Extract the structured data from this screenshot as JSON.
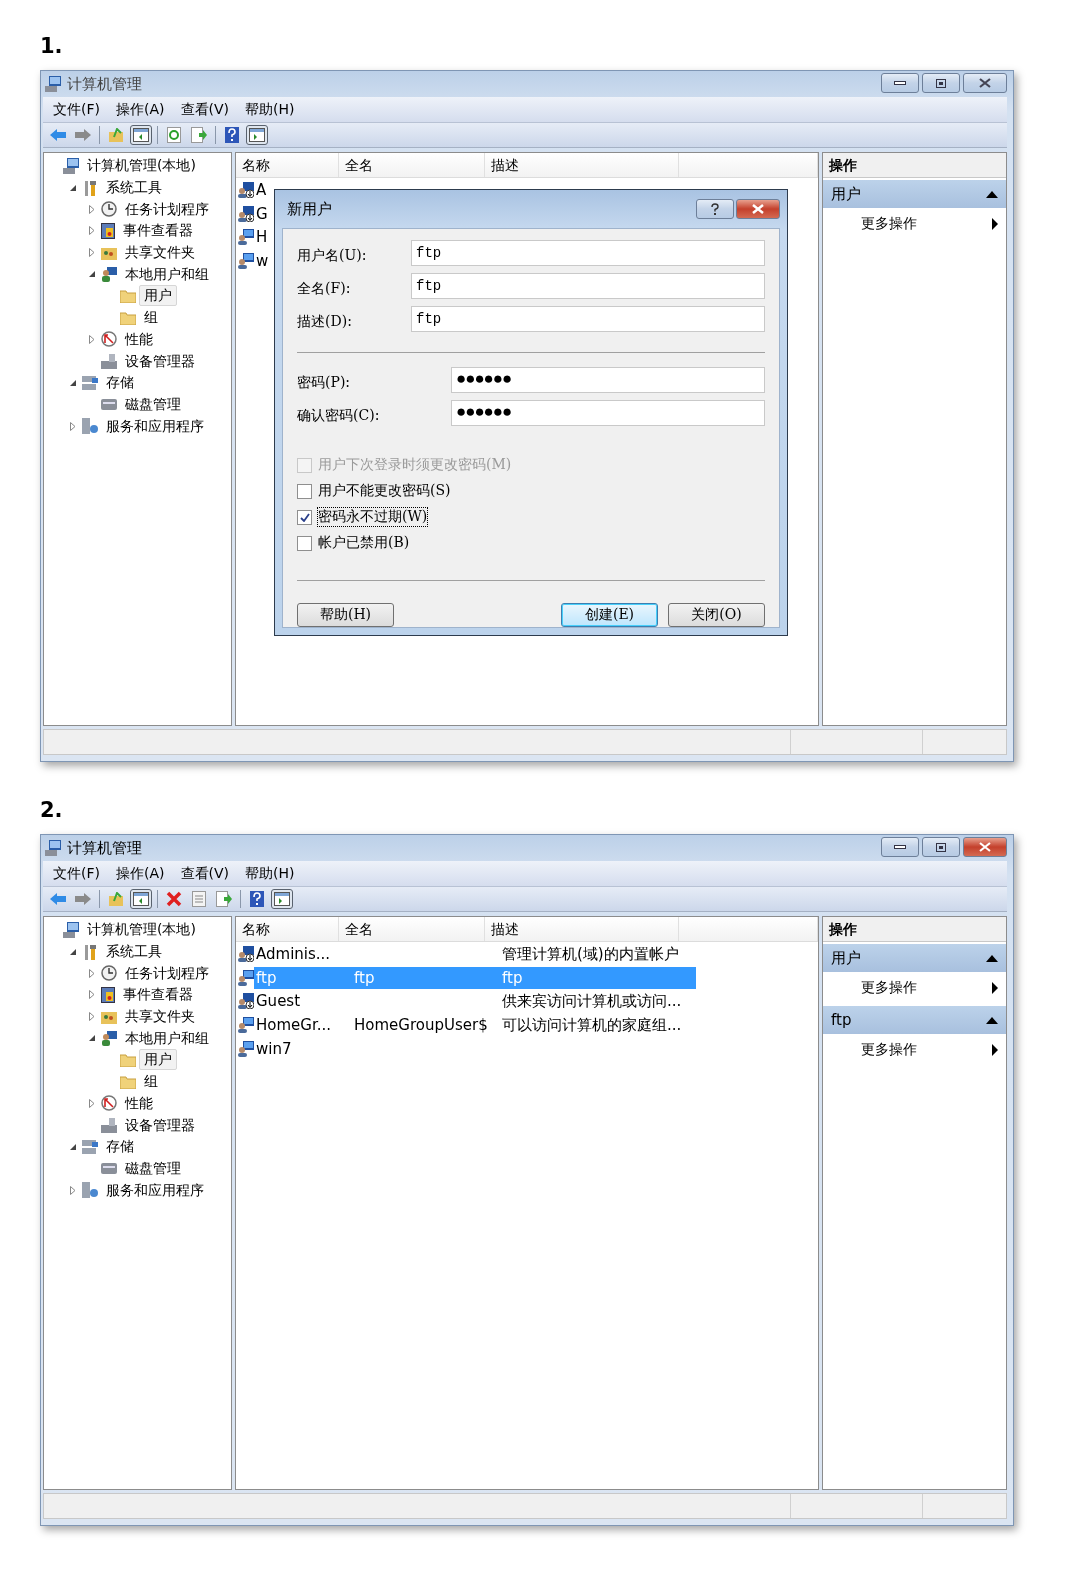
{
  "sections": [
    {
      "label": "1.",
      "window": {
        "title": "计算机管理",
        "active": false,
        "menu": [
          "文件(F)",
          "操作(A)",
          "查看(V)",
          "帮助(H)"
        ],
        "toolbar": [
          {
            "kind": "back",
            "pressed": false
          },
          {
            "kind": "forward",
            "pressed": false
          },
          {
            "kind": "separator"
          },
          {
            "kind": "up",
            "pressed": false
          },
          {
            "kind": "show-tree",
            "pressed": true
          },
          {
            "kind": "separator"
          },
          {
            "kind": "refresh",
            "pressed": false
          },
          {
            "kind": "export",
            "pressed": false
          },
          {
            "kind": "separator"
          },
          {
            "kind": "help",
            "pressed": false
          },
          {
            "kind": "show-action",
            "pressed": true
          }
        ],
        "tree": [
          {
            "label": "计算机管理(本地)",
            "kind": "computer",
            "selected": false,
            "children": [
              {
                "label": "系统工具",
                "kind": "tools",
                "expanded": true,
                "selected": false,
                "children": [
                  {
                    "label": "任务计划程序",
                    "kind": "clock",
                    "expanded": false,
                    "selected": false
                  },
                  {
                    "label": "事件查看器",
                    "kind": "event",
                    "expanded": false,
                    "selected": false
                  },
                  {
                    "label": "共享文件夹",
                    "kind": "share",
                    "expanded": false,
                    "selected": false
                  },
                  {
                    "label": "本地用户和组",
                    "kind": "users",
                    "expanded": true,
                    "selected": false,
                    "children": [
                      {
                        "label": "用户",
                        "kind": "folder",
                        "selected": true
                      },
                      {
                        "label": "组",
                        "kind": "folder",
                        "selected": false
                      }
                    ]
                  },
                  {
                    "label": "性能",
                    "kind": "perf",
                    "expanded": false,
                    "selected": false
                  },
                  {
                    "label": "设备管理器",
                    "kind": "device",
                    "selected": false
                  }
                ]
              },
              {
                "label": "存储",
                "kind": "storage",
                "expanded": true,
                "selected": false,
                "children": [
                  {
                    "label": "磁盘管理",
                    "kind": "disk",
                    "selected": false
                  }
                ]
              },
              {
                "label": "服务和应用程序",
                "kind": "services",
                "expanded": false,
                "selected": false
              }
            ]
          }
        ],
        "columns": [
          "名称",
          "全名",
          "描述"
        ],
        "rows": [
          {
            "kind": "disabled-user",
            "name": "A",
            "selected": false
          },
          {
            "kind": "disabled-user",
            "name": "G",
            "selected": false
          },
          {
            "kind": "user",
            "name": "H",
            "selected": false
          },
          {
            "kind": "user",
            "name": "w",
            "selected": false
          }
        ],
        "actions": {
          "title": "操作",
          "sections": [
            {
              "title": "用户",
              "items": [
                "更多操作"
              ]
            }
          ]
        },
        "dialog": {
          "title": "新用户",
          "fields": [
            {
              "kind": "text",
              "label": "用户名(U):",
              "value": "ftp"
            },
            {
              "kind": "text",
              "label": "全名(F):",
              "value": "ftp"
            },
            {
              "kind": "text",
              "label": "描述(D):",
              "value": "ftp"
            },
            {
              "kind": "separator"
            },
            {
              "kind": "password",
              "label": "密码(P):",
              "value": "●●●●●●"
            },
            {
              "kind": "password",
              "label": "确认密码(C):",
              "value": "●●●●●●"
            }
          ],
          "checkboxes": [
            {
              "label": "用户下次登录时须更改密码(M)",
              "checked": false,
              "disabled": true,
              "focused": false
            },
            {
              "label": "用户不能更改密码(S)",
              "checked": false,
              "disabled": false,
              "focused": false
            },
            {
              "label": "密码永不过期(W)",
              "checked": true,
              "disabled": false,
              "focused": true
            },
            {
              "label": "帐户已禁用(B)",
              "checked": false,
              "disabled": false,
              "focused": false
            }
          ],
          "buttons": [
            {
              "label": "帮助(H)",
              "default": false
            },
            {
              "label": "创建(E)",
              "default": true
            },
            {
              "label": "关闭(O)",
              "default": false
            }
          ]
        }
      }
    },
    {
      "label": "2.",
      "window": {
        "title": "计算机管理",
        "active": true,
        "menu": [
          "文件(F)",
          "操作(A)",
          "查看(V)",
          "帮助(H)"
        ],
        "toolbar": [
          {
            "kind": "back",
            "pressed": false
          },
          {
            "kind": "forward",
            "pressed": false
          },
          {
            "kind": "separator"
          },
          {
            "kind": "up",
            "pressed": false
          },
          {
            "kind": "show-tree",
            "pressed": true
          },
          {
            "kind": "separator"
          },
          {
            "kind": "delete",
            "pressed": false
          },
          {
            "kind": "properties",
            "pressed": false
          },
          {
            "kind": "export",
            "pressed": false
          },
          {
            "kind": "separator"
          },
          {
            "kind": "help",
            "pressed": false
          },
          {
            "kind": "show-action",
            "pressed": true
          }
        ],
        "tree": [
          {
            "label": "计算机管理(本地)",
            "kind": "computer",
            "selected": false,
            "children": [
              {
                "label": "系统工具",
                "kind": "tools",
                "expanded": true,
                "selected": false,
                "children": [
                  {
                    "label": "任务计划程序",
                    "kind": "clock",
                    "expanded": false,
                    "selected": false
                  },
                  {
                    "label": "事件查看器",
                    "kind": "event",
                    "expanded": false,
                    "selected": false
                  },
                  {
                    "label": "共享文件夹",
                    "kind": "share",
                    "expanded": false,
                    "selected": false
                  },
                  {
                    "label": "本地用户和组",
                    "kind": "users",
                    "expanded": true,
                    "selected": false,
                    "children": [
                      {
                        "label": "用户",
                        "kind": "folder",
                        "selected": true
                      },
                      {
                        "label": "组",
                        "kind": "folder",
                        "selected": false
                      }
                    ]
                  },
                  {
                    "label": "性能",
                    "kind": "perf",
                    "expanded": false,
                    "selected": false
                  },
                  {
                    "label": "设备管理器",
                    "kind": "device",
                    "selected": false
                  }
                ]
              },
              {
                "label": "存储",
                "kind": "storage",
                "expanded": true,
                "selected": false,
                "children": [
                  {
                    "label": "磁盘管理",
                    "kind": "disk",
                    "selected": false
                  }
                ]
              },
              {
                "label": "服务和应用程序",
                "kind": "services",
                "expanded": false,
                "selected": false
              }
            ]
          }
        ],
        "columns": [
          "名称",
          "全名",
          "描述"
        ],
        "rows": [
          {
            "kind": "disabled-user",
            "name": "Adminis...",
            "description": "管理计算机(域)的内置帐户",
            "selected": false
          },
          {
            "kind": "user",
            "name": "ftp",
            "full_name": "ftp",
            "description": "ftp",
            "selected": true
          },
          {
            "kind": "disabled-user",
            "name": "Guest",
            "description": "供来宾访问计算机或访问...",
            "selected": false
          },
          {
            "kind": "user",
            "name": "HomeGr...",
            "full_name": "HomeGroupUser$",
            "description": "可以访问计算机的家庭组...",
            "selected": false
          },
          {
            "kind": "user",
            "name": "win7",
            "selected": false
          }
        ],
        "actions": {
          "title": "操作",
          "sections": [
            {
              "title": "用户",
              "items": [
                "更多操作"
              ]
            },
            {
              "title": "ftp",
              "items": [
                "更多操作"
              ]
            }
          ]
        }
      }
    }
  ]
}
